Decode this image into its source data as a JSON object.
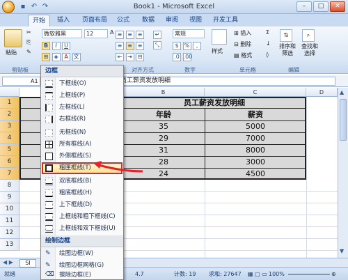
{
  "window": {
    "title": "Book1 - Microsoft Excel",
    "qat": [
      "↶",
      "↷"
    ],
    "controls": [
      "–",
      "□",
      "✕"
    ]
  },
  "tabs": [
    "开始",
    "插入",
    "页面布局",
    "公式",
    "数据",
    "审阅",
    "视图",
    "开发工具"
  ],
  "ribbon": {
    "paste_label": "粘贴",
    "font_name": "微软雅黑",
    "font_size": "12",
    "number_format": "常规",
    "style_label": "样式",
    "insert_label": "插入",
    "delete_label": "删除",
    "format_label": "格式",
    "sort_filter_label": "排序和\n筛选",
    "find_select_label": "查找和\n选择",
    "groups": {
      "clipboard": "剪贴板",
      "alignment": "对齐方式",
      "number": "数字",
      "cells": "单元格",
      "edit": "编辑"
    }
  },
  "formula_bar": {
    "cell_ref": "A1",
    "formula": "员工薪资发放明细"
  },
  "grid": {
    "columns": [
      "B",
      "C",
      "D"
    ],
    "rows": [
      "1",
      "2",
      "3",
      "4",
      "5",
      "6",
      "7",
      "8",
      "9",
      "10",
      "11",
      "12",
      "13"
    ],
    "table": {
      "title": "员工薪资发放明细",
      "headers": [
        "年龄",
        "薪资"
      ],
      "data": [
        [
          "35",
          "5000"
        ],
        [
          "29",
          "7000"
        ],
        [
          "31",
          "8000"
        ],
        [
          "28",
          "3000"
        ],
        [
          "24",
          "4500"
        ]
      ]
    }
  },
  "menu": {
    "header_borders": "边框",
    "items": [
      "下框线(O)",
      "上框线(P)",
      "左框线(L)",
      "右框线(R)",
      "无框线(N)",
      "所有框线(A)",
      "外侧框线(S)",
      "粗匣框线(T)",
      "双底框线(B)",
      "粗底框线(H)",
      "上下框线(D)",
      "上框线和粗下框线(C)",
      "上框线和双下框线(U)"
    ],
    "header_draw": "绘制边框",
    "draw_items": [
      "绘图边框(W)",
      "绘图边框网格(G)",
      "擦除边框(E)"
    ]
  },
  "sheet_tab": "SI",
  "status": {
    "mode": "就绪",
    "average": "4.7",
    "count": "计数: 19",
    "sum": "求和: 27647",
    "zoom": "100%"
  }
}
